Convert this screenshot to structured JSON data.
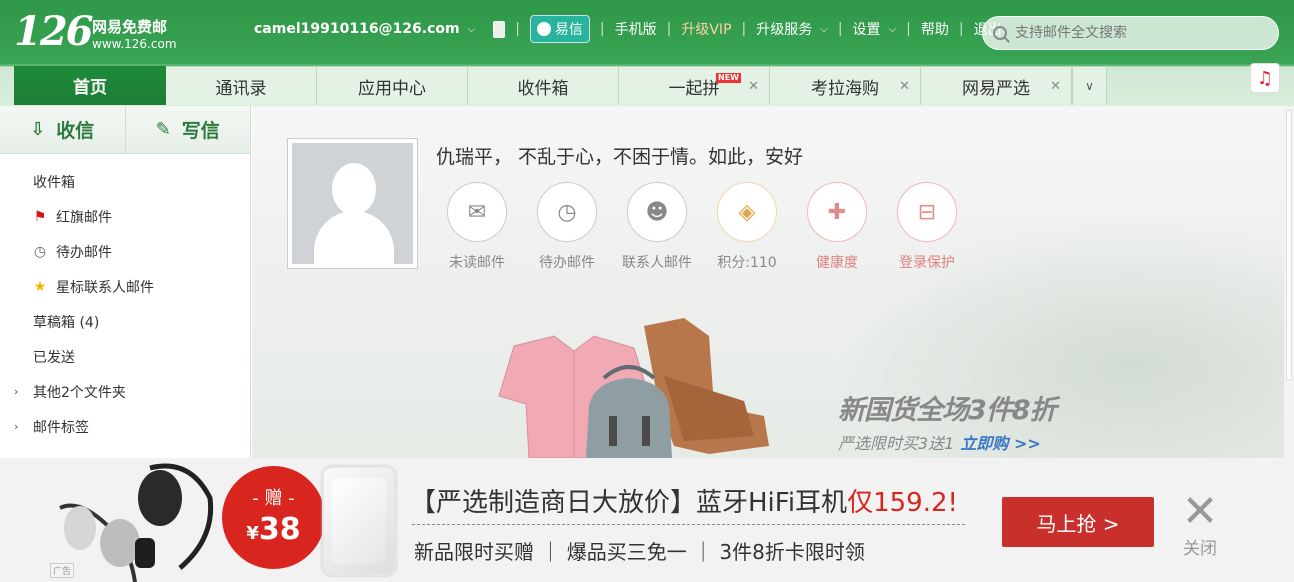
{
  "logo": {
    "number": "126",
    "name": "网易免费邮",
    "url": "www.126.com"
  },
  "topnav": {
    "account": "camel19910116@126.com",
    "yixin": "易信",
    "mobile": "手机版",
    "vip": "升级VIP",
    "services": "升级服务",
    "settings": "设置",
    "help": "帮助",
    "logout": "退出"
  },
  "search": {
    "placeholder": "支持邮件全文搜索"
  },
  "tabs": [
    {
      "label": "首页"
    },
    {
      "label": "通讯录"
    },
    {
      "label": "应用中心"
    },
    {
      "label": "收件箱"
    },
    {
      "label": "一起拼",
      "badge": "NEW"
    },
    {
      "label": "考拉海购"
    },
    {
      "label": "网易严选"
    }
  ],
  "sidebar": {
    "receive": "收信",
    "compose": "写信",
    "folders": [
      "收件箱",
      "红旗邮件",
      "待办邮件",
      "星标联系人邮件",
      "草稿箱 (4)",
      "已发送",
      "其他2个文件夹",
      "邮件标签"
    ]
  },
  "main": {
    "greeting": "仇瑞平， 不乱于心，不困于情。如此，安好",
    "stats": [
      {
        "label": "未读邮件"
      },
      {
        "label": "待办邮件"
      },
      {
        "label": "联系人邮件"
      },
      {
        "label": "积分:110"
      },
      {
        "label": "健康度"
      },
      {
        "label": "登录保护"
      }
    ],
    "promo_title": "新国货全场3件8折",
    "promo_sub": "严选限时买3送1",
    "promo_link": "立即购 >>"
  },
  "ad": {
    "tag": "广告",
    "give": "- 赠 -",
    "price_symbol": "¥",
    "price": "38",
    "headline_a": "【严选制造商日大放价】蓝牙HiFi耳机",
    "headline_b": "仅159.2!",
    "subline": "新品限时买赠 ｜ 爆品买三免一 ｜ 3件8折卡限时领",
    "cta": "马上抢 >",
    "close": "关闭"
  }
}
